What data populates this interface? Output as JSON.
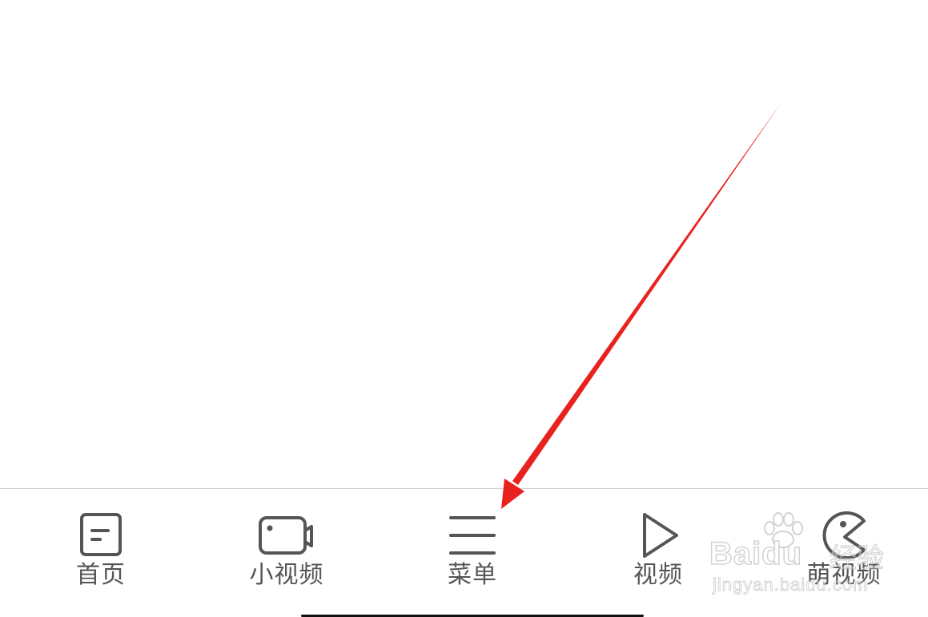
{
  "tabbar": {
    "tabs": [
      {
        "label": "首页",
        "icon": "document-icon"
      },
      {
        "label": "小视频",
        "icon": "camera-icon"
      },
      {
        "label": "菜单",
        "icon": "menu-icon"
      },
      {
        "label": "视频",
        "icon": "play-icon"
      },
      {
        "label": "萌视频",
        "icon": "pacman-icon"
      }
    ]
  },
  "annotation": {
    "arrow_color": "#e8231f",
    "target": "菜单"
  },
  "watermark": {
    "brand": "Baidu",
    "cn": "经验",
    "url": "jingyan.baidu.com"
  },
  "colors": {
    "icon": "#555555",
    "label": "#555555",
    "divider": "#cfcfcf",
    "background": "#ffffff"
  }
}
